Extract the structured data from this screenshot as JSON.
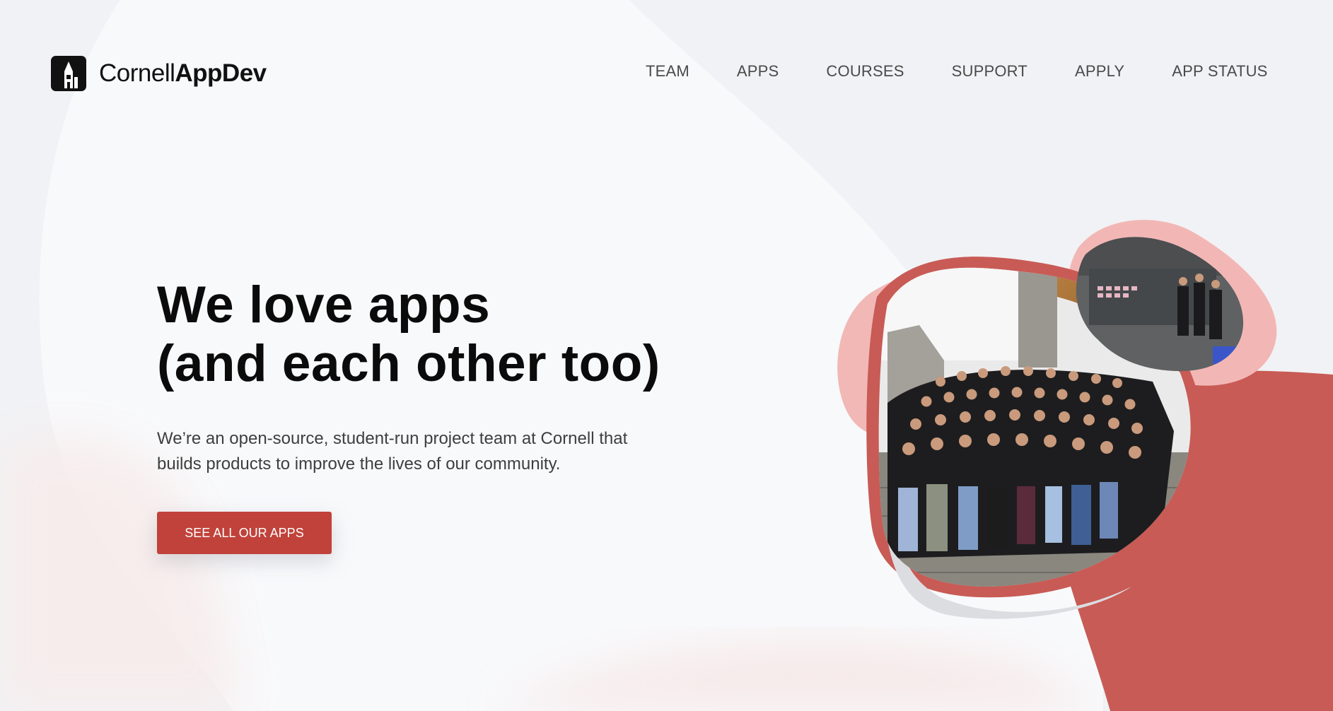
{
  "header": {
    "logo_light": "Cornell",
    "logo_bold": "AppDev",
    "nav": [
      "TEAM",
      "APPS",
      "COURSES",
      "SUPPORT",
      "APPLY",
      "APP STATUS"
    ]
  },
  "hero": {
    "headline_line1": "We love apps",
    "headline_line2": "(and each other too)",
    "subtitle": "We’re an open-source, student-run project team at Cornell that builds products to improve the lives of our community.",
    "cta_label": "SEE ALL OUR APPS"
  },
  "photos": {
    "main": "group-photo-on-stairs",
    "secondary": "students-at-whiteboard"
  },
  "colors": {
    "accent": "#c0423a",
    "blob_red": "#c85b55",
    "blob_pink": "#f0b4b2",
    "background": "#f1f2f5"
  }
}
